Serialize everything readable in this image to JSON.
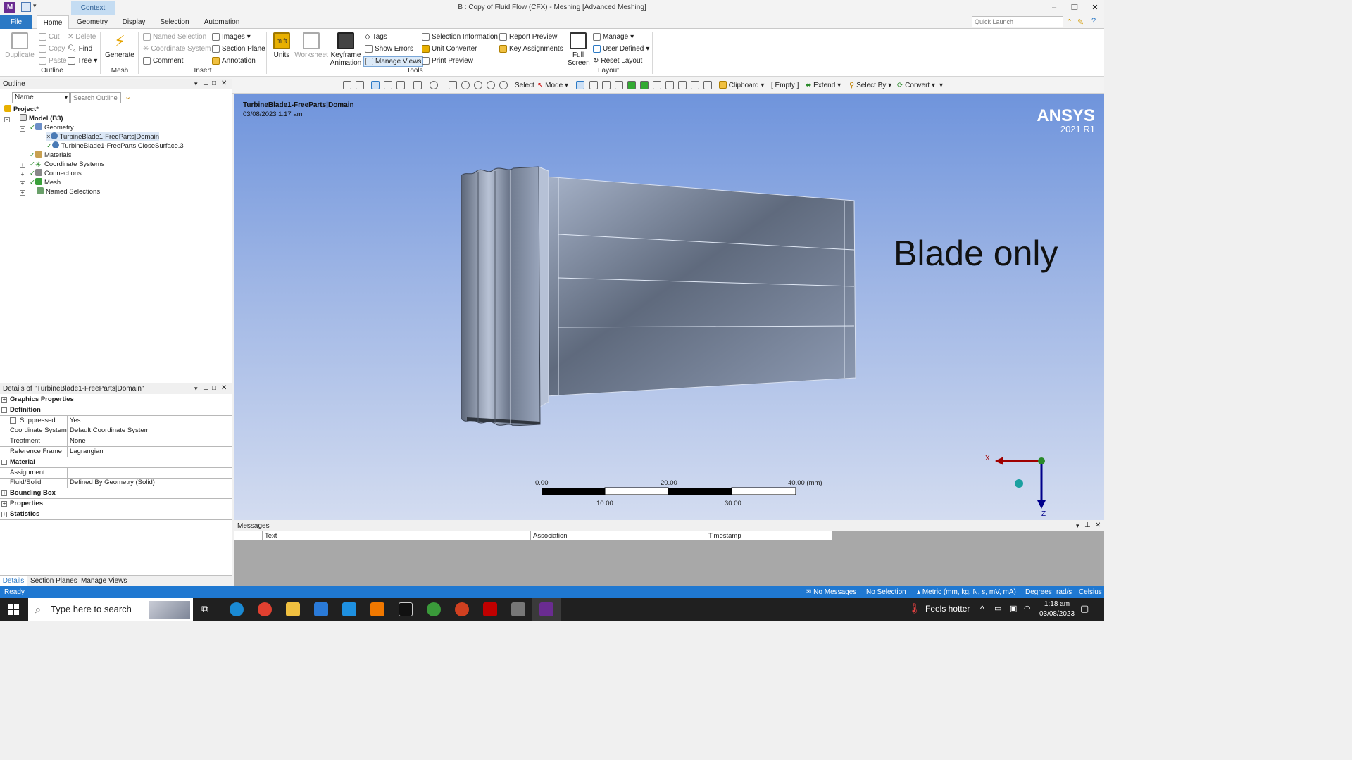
{
  "window": {
    "app_icon": "M",
    "context_tab": "Context",
    "title": "B : Copy of Fluid Flow (CFX) - Meshing [Advanced Meshing]",
    "quick_launch_placeholder": "Quick Launch",
    "controls": {
      "minimize": "–",
      "restore": "❐",
      "close": "✕"
    }
  },
  "ribbon_tabs": [
    "File",
    "Home",
    "Geometry",
    "Display",
    "Selection",
    "Automation"
  ],
  "ribbon": {
    "outline": {
      "label": "Outline",
      "duplicate": "Duplicate",
      "cut": "Cut",
      "copy": "Copy",
      "paste": "Paste",
      "delete": "Delete",
      "find": "Find",
      "tree": "Tree"
    },
    "mesh": {
      "label": "Mesh",
      "generate": "Generate"
    },
    "insert": {
      "label": "Insert",
      "named_selection": "Named Selection",
      "coordinate_system": "Coordinate System",
      "comment": "Comment",
      "images": "Images",
      "section_plane": "Section Plane",
      "annotation": "Annotation"
    },
    "tools": {
      "label": "Tools",
      "units": "Units",
      "worksheet": "Worksheet",
      "keyframe_1": "Keyframe",
      "keyframe_2": "Animation",
      "tags": "Tags",
      "show_errors": "Show Errors",
      "manage_views": "Manage Views",
      "selection_information": "Selection Information",
      "unit_converter": "Unit Converter",
      "print_preview": "Print Preview",
      "report_preview": "Report Preview",
      "key_assignments": "Key Assignments"
    },
    "layout": {
      "label": "Layout",
      "full_1": "Full",
      "full_2": "Screen",
      "manage": "Manage",
      "user_defined": "User Defined",
      "reset_layout": "Reset Layout"
    }
  },
  "toolbar": {
    "select": "Select",
    "mode": "Mode",
    "clipboard": "Clipboard",
    "empty": "[ Empty ]",
    "extend": "Extend",
    "select_by": "Select By",
    "convert": "Convert"
  },
  "outline": {
    "title": "Outline",
    "filter_name": "Name",
    "search_placeholder": "Search Outline",
    "items": [
      "Project*",
      "Model (B3)",
      "Geometry",
      "TurbineBlade1-FreeParts|Domain",
      "TurbineBlade1-FreeParts|CloseSurface.3",
      "Materials",
      "Coordinate Systems",
      "Connections",
      "Mesh",
      "Named Selections"
    ]
  },
  "details": {
    "title": "Details of \"TurbineBlade1-FreeParts|Domain\"",
    "rows": [
      {
        "k": "Graphics Properties",
        "v": "",
        "cat": true,
        "sign": "+"
      },
      {
        "k": "Definition",
        "v": "",
        "cat": true,
        "sign": "−"
      },
      {
        "k": "Suppressed",
        "v": "Yes",
        "cat": false
      },
      {
        "k": "Coordinate System",
        "v": "Default Coordinate System",
        "cat": false
      },
      {
        "k": "Treatment",
        "v": "None",
        "cat": false
      },
      {
        "k": "Reference Frame",
        "v": "Lagrangian",
        "cat": false
      },
      {
        "k": "Material",
        "v": "",
        "cat": true,
        "sign": "−"
      },
      {
        "k": "Assignment",
        "v": "",
        "cat": false
      },
      {
        "k": "Fluid/Solid",
        "v": "Defined By Geometry (Solid)",
        "cat": false
      },
      {
        "k": "Bounding Box",
        "v": "",
        "cat": true,
        "sign": "+"
      },
      {
        "k": "Properties",
        "v": "",
        "cat": true,
        "sign": "+"
      },
      {
        "k": "Statistics",
        "v": "",
        "cat": true,
        "sign": "+"
      }
    ],
    "bottom_tabs": [
      "Details",
      "Section Planes",
      "Manage Views"
    ]
  },
  "viewport": {
    "title": "TurbineBlade1-FreeParts|Domain",
    "date": "03/08/2023 1:17 am",
    "logo_name": "ANSYS",
    "logo_version": "2021 R1",
    "annotation": "Blade only",
    "scale": {
      "top": [
        "0.00",
        "20.00",
        "40.00 (mm)"
      ],
      "bottom": [
        "10.00",
        "30.00"
      ]
    },
    "axes": {
      "x": "X",
      "z": "Z"
    }
  },
  "messages": {
    "title": "Messages",
    "columns": [
      "Text",
      "Association",
      "Timestamp"
    ]
  },
  "status": {
    "ready": "Ready",
    "messages": "No Messages",
    "selection": "No Selection",
    "units": "Metric (mm, kg, N, s, mV, mA)",
    "angle": "Degrees",
    "rate": "rad/s",
    "temp": "Celsius"
  },
  "taskbar": {
    "search": "Type here to search",
    "weather": "Feels hotter",
    "time": "1:18 am",
    "date": "03/08/2023"
  },
  "colors": {
    "accent": "#1f78d1",
    "viewport_top": "#6f94dc",
    "viewport_bottom": "#d3dcf0"
  }
}
